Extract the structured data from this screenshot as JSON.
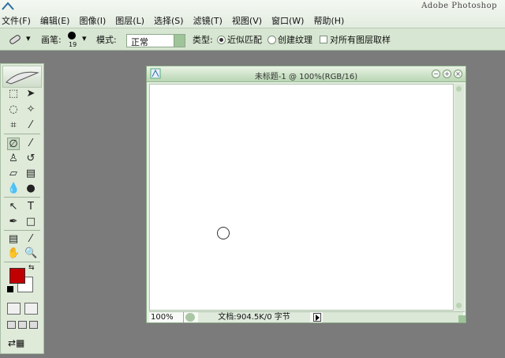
{
  "app": {
    "title": "Adobe Photoshop"
  },
  "menu": [
    "文件(F)",
    "编辑(E)",
    "图像(I)",
    "图层(L)",
    "选择(S)",
    "滤镜(T)",
    "视图(V)",
    "窗口(W)",
    "帮助(H)"
  ],
  "options": {
    "brush_label": "画笔:",
    "brush_size": "19",
    "mode_label": "模式:",
    "mode_value": "正常",
    "type_label": "类型:",
    "type_option_1": "近似匹配",
    "type_option_2": "创建纹理",
    "sample_all_layers": "对所有图层取样"
  },
  "document": {
    "title": "未标题-1 @ 100%(RGB/16)",
    "zoom": "100%",
    "info": "文档:904.5K/0 字节"
  },
  "colors": {
    "foreground": "#c00000",
    "background": "#ffffff",
    "accent": "#d7e6d2"
  },
  "tools": [
    "marquee-icon",
    "move-icon",
    "lasso-icon",
    "magic-wand-icon",
    "crop-icon",
    "slice-icon",
    "healing-brush-icon",
    "brush-icon",
    "clone-stamp-icon",
    "history-brush-icon",
    "eraser-icon",
    "gradient-icon",
    "blur-icon",
    "dodge-icon",
    "path-selection-icon",
    "type-icon",
    "pen-icon",
    "shape-icon",
    "notes-icon",
    "eyedropper-icon",
    "hand-icon",
    "zoom-icon"
  ]
}
